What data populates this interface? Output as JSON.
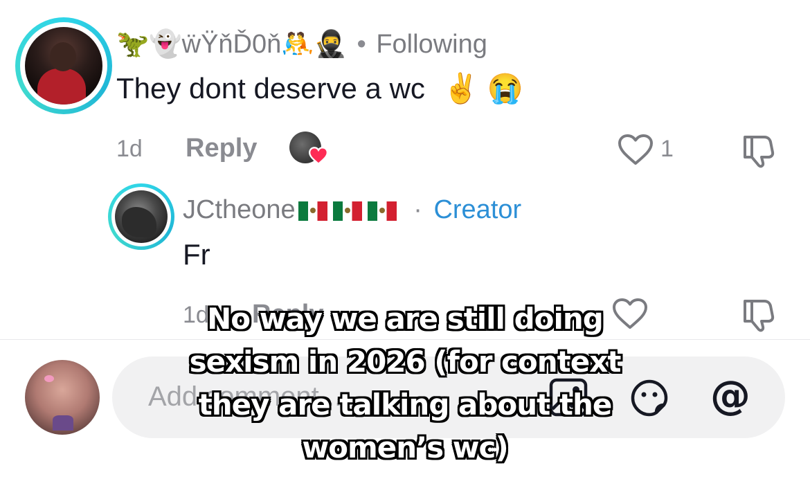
{
  "comment": {
    "username": "🦖👻ẅŸňĎ0ň🤼🥷",
    "separator": "•",
    "following": "Following",
    "text": "They dont deserve a wc",
    "emoji": "✌️ 😭",
    "age": "1d",
    "reply_label": "Reply",
    "like_count": "1"
  },
  "reply": {
    "username": "JCtheone",
    "separator": "·",
    "badge": "Creator",
    "text": "Fr",
    "age": "1d",
    "reply_label": "Reply"
  },
  "input": {
    "placeholder": "Add comment..."
  },
  "overlay": {
    "caption": "No way we are still doing sexism in 2026 (for context they are talking about the women’s wc)"
  },
  "colors": {
    "ring": "#2fd5e8",
    "creator": "#2c8fd6",
    "muted": "#8a8b91",
    "heart": "#fe2c55"
  }
}
